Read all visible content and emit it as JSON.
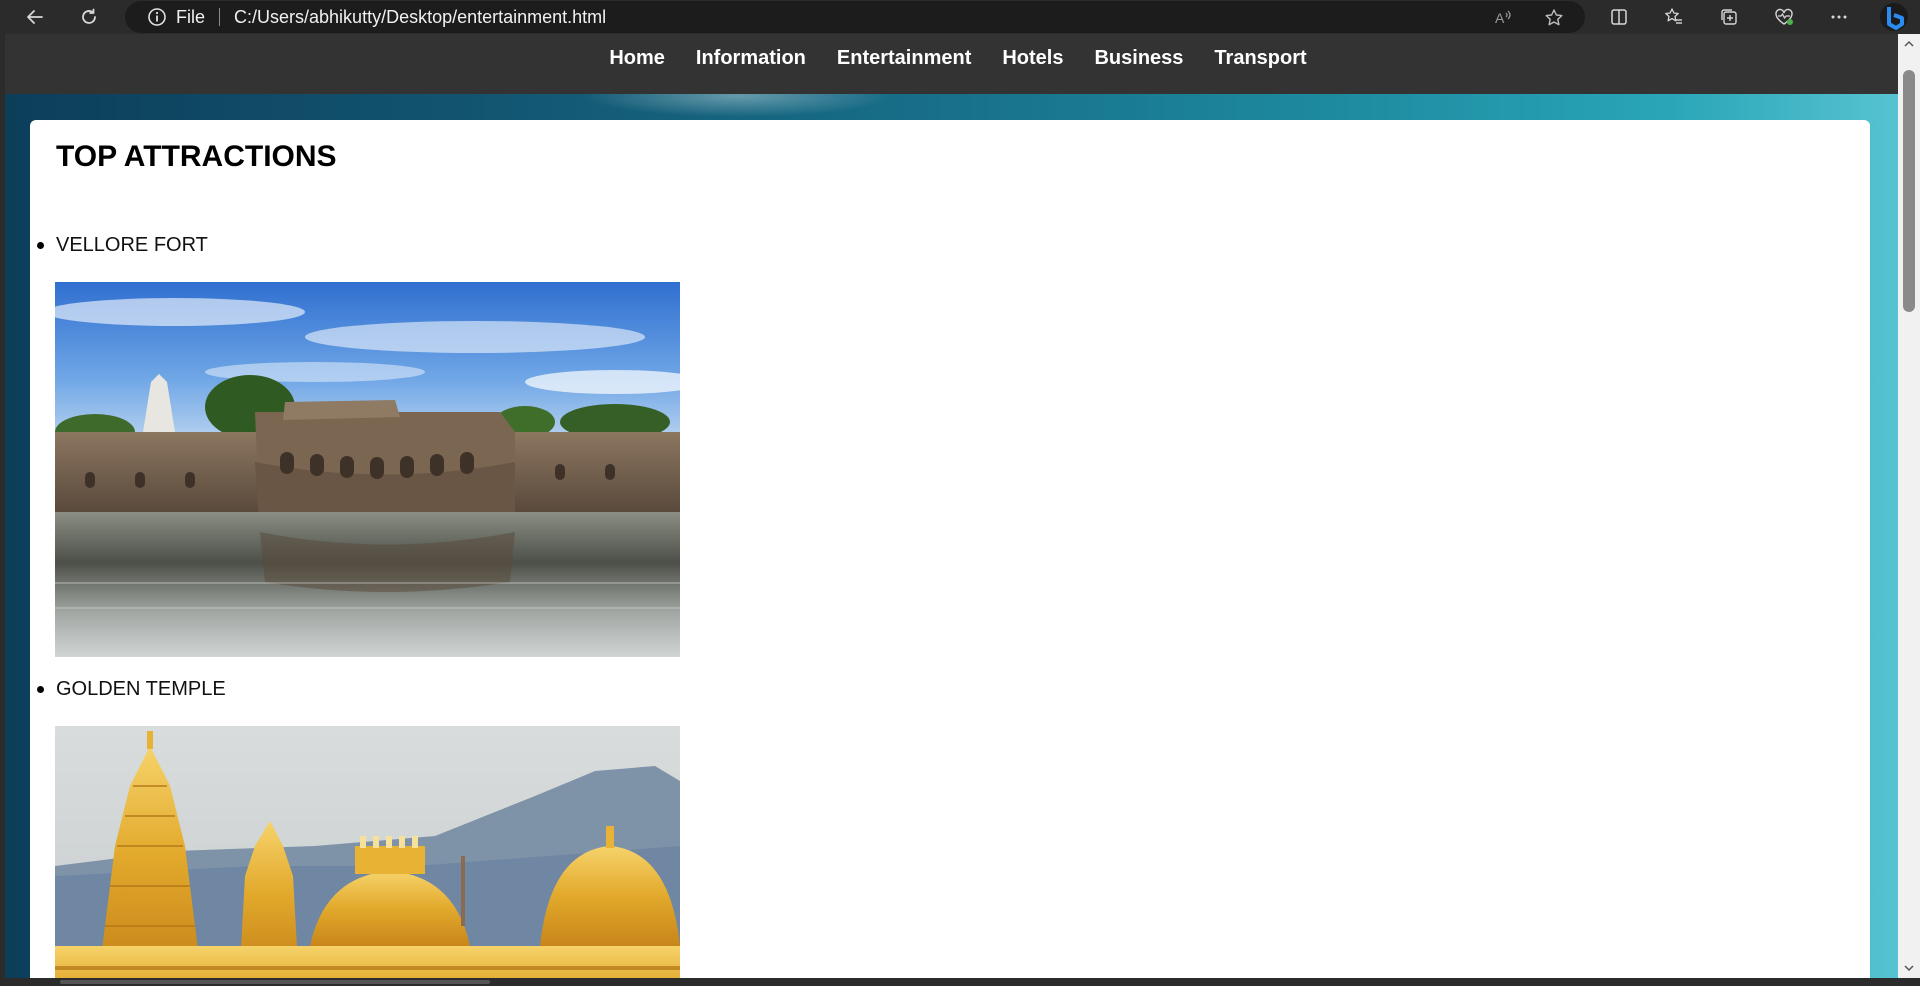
{
  "browser": {
    "address_scheme": "File",
    "url": "C:/Users/abhikutty/Desktop/entertainment.html",
    "icons": [
      "back-icon",
      "refresh-icon",
      "info-icon",
      "read-aloud-icon",
      "favorite-star-icon",
      "split-screen-icon",
      "favorites-icon",
      "collections-icon",
      "browser-essentials-icon",
      "more-icon",
      "copilot-icon"
    ]
  },
  "nav": {
    "links": [
      "Home",
      "Information",
      "Entertainment",
      "Hotels",
      "Business",
      "Transport"
    ]
  },
  "main": {
    "title": "TOP ATTRACTIONS",
    "attractions": [
      {
        "label": "VELLORE FORT"
      },
      {
        "label": "GOLDEN TEMPLE"
      }
    ]
  },
  "colors": {
    "navbar": "#333333",
    "page_gradient_start": "#0c3e5a",
    "page_gradient_end": "#56c3d1",
    "card": "#ffffff",
    "chrome": "#2b2b2b"
  }
}
